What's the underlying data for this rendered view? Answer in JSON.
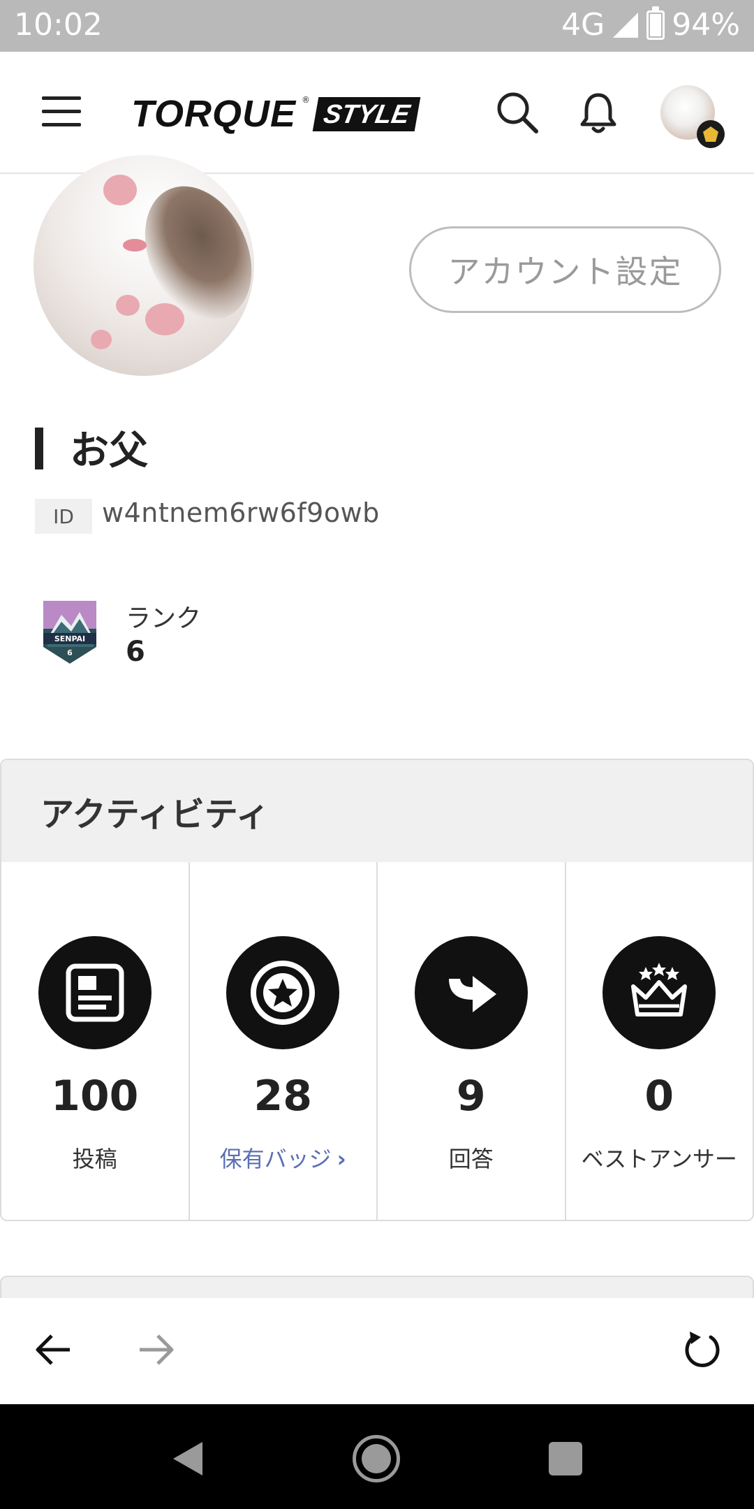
{
  "status_bar": {
    "time": "10:02",
    "network": "4G",
    "battery": "94%",
    "battery_level": 0.94
  },
  "header": {
    "logo_main": "TORQUE",
    "logo_reg": "®",
    "logo_sub": "STYLE",
    "icons": [
      "menu-icon",
      "search-icon",
      "bell-icon",
      "avatar"
    ]
  },
  "profile": {
    "account_settings_label": "アカウント設定",
    "name": "お父",
    "id_label": "ID",
    "id_value": "w4ntnem6rw6f9owb",
    "rank_label": "ランク",
    "rank_value": "6",
    "rank_badge_text": "SENPAI",
    "rank_badge_number": "6"
  },
  "activity": {
    "title": "アクティビティ",
    "items": [
      {
        "icon": "post-icon",
        "value": "100",
        "label": "投稿"
      },
      {
        "icon": "badge-star-icon",
        "value": "28",
        "label": "保有バッジ",
        "link": true
      },
      {
        "icon": "reply-arrow-icon",
        "value": "9",
        "label": "回答"
      },
      {
        "icon": "crown-icon",
        "value": "0",
        "label": "ベストアンサー"
      }
    ]
  },
  "browser_nav": {
    "icons": [
      "back-arrow-icon",
      "forward-arrow-icon",
      "reload-icon"
    ]
  },
  "colors": {
    "status_bar_bg": "#b9b9b9",
    "link": "#5a6fb4",
    "activity_header_bg": "#f0f0f0"
  }
}
